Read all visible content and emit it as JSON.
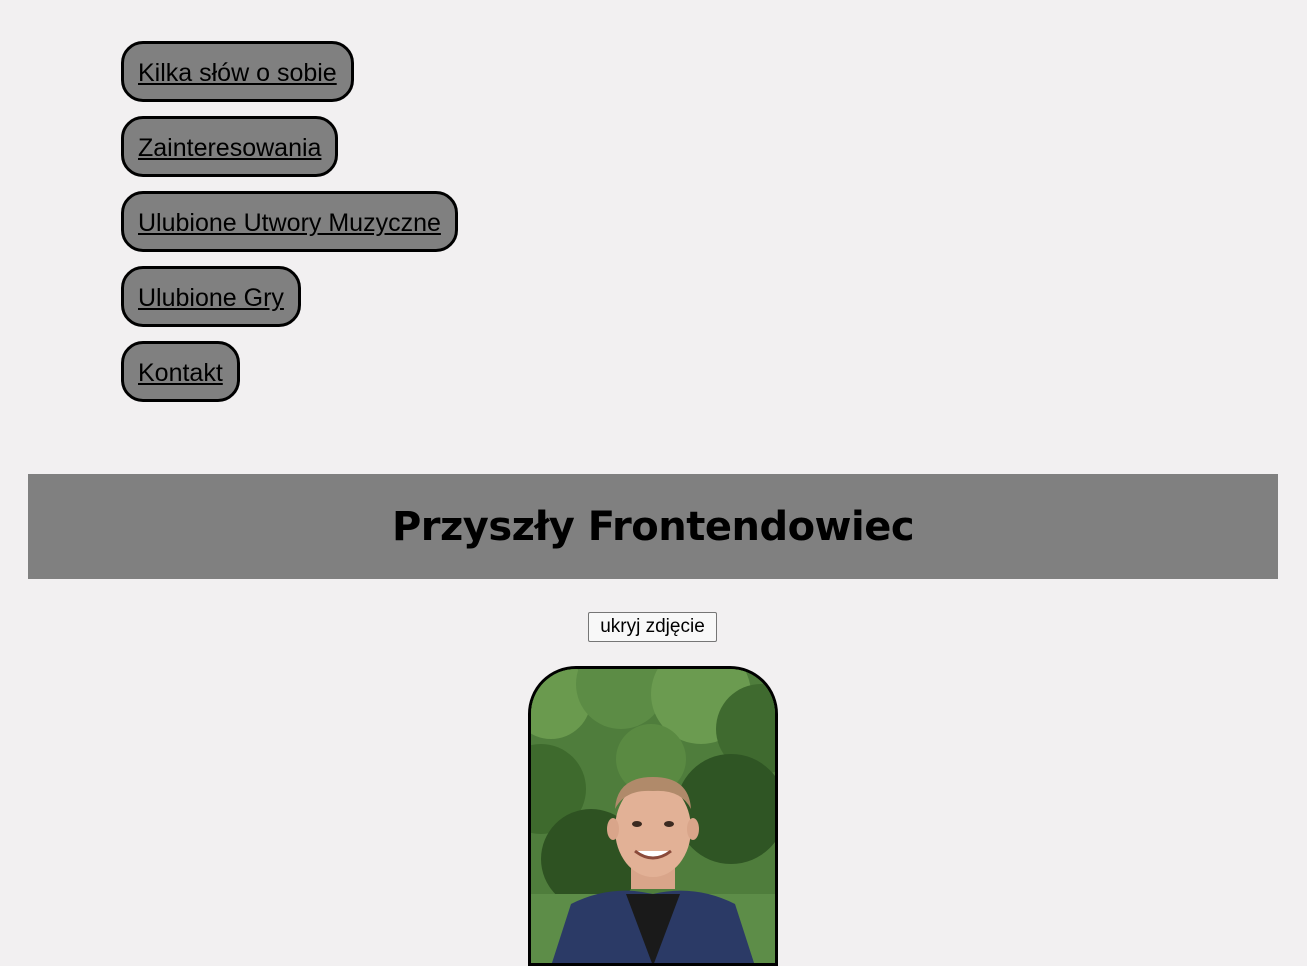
{
  "nav": {
    "items": [
      {
        "label": "Kilka słów o sobie"
      },
      {
        "label": "Zainteresowania"
      },
      {
        "label": "Ulubione Utwory Muzyczne"
      },
      {
        "label": "Ulubione Gry"
      },
      {
        "label": "Kontakt"
      }
    ]
  },
  "banner": {
    "title": "Przyszły Frontendowiec"
  },
  "photo_toggle": {
    "label": "ukryj zdjęcie"
  },
  "colors": {
    "page_background": "#f2f0f1",
    "nav_button_background": "#808080",
    "banner_background": "#808080",
    "border": "#000000"
  }
}
